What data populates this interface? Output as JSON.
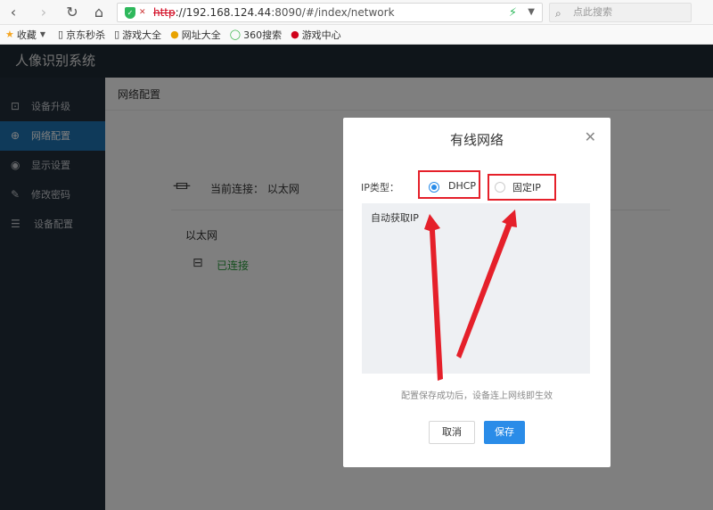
{
  "browser": {
    "url_protocol": "http",
    "url_host": "://192.168.124.44",
    "url_rest": ":8090/#/index/network",
    "search_placeholder": "点此搜索"
  },
  "bookmarks": [
    {
      "label": "收藏",
      "icon": "star-icon"
    },
    {
      "label": "京东秒杀",
      "icon": "page-icon"
    },
    {
      "label": "游戏大全",
      "icon": "page-icon"
    },
    {
      "label": "网址大全",
      "icon": "nav-globe-icon"
    },
    {
      "label": "360搜索",
      "icon": "search-360-icon"
    },
    {
      "label": "游戏中心",
      "icon": "game-icon"
    }
  ],
  "app": {
    "title": "人像识别系统"
  },
  "sidebar": {
    "items": [
      {
        "label": "设备升级",
        "icon": "upgrade-icon",
        "active": false
      },
      {
        "label": "网络配置",
        "icon": "globe-icon",
        "active": true
      },
      {
        "label": "显示设置",
        "icon": "eye-icon",
        "active": false
      },
      {
        "label": "修改密码",
        "icon": "edit-icon",
        "active": false
      },
      {
        "label": "设备配置",
        "icon": "sliders-icon",
        "active": false
      }
    ]
  },
  "main": {
    "page_title": "网络配置",
    "current_connection": "当前连接： 以太网",
    "ethernet_title": "以太网",
    "ethernet_status": "已连接"
  },
  "modal": {
    "title": "有线网络",
    "ip_type_label": "IP类型：",
    "options": [
      {
        "label": "DHCP",
        "selected": true
      },
      {
        "label": "固定IP",
        "selected": false
      }
    ],
    "panel_text": "自动获取IP",
    "hint": "配置保存成功后，设备连上网线即生效",
    "cancel_label": "取消",
    "save_label": "保存"
  },
  "colors": {
    "header_bg": "#1f2a35",
    "sidebar_bg": "#232f3b",
    "active_item": "#1e74b4",
    "primary": "#2a8ce8",
    "success": "#2a9d3d",
    "annotation_red": "#e5202a"
  }
}
